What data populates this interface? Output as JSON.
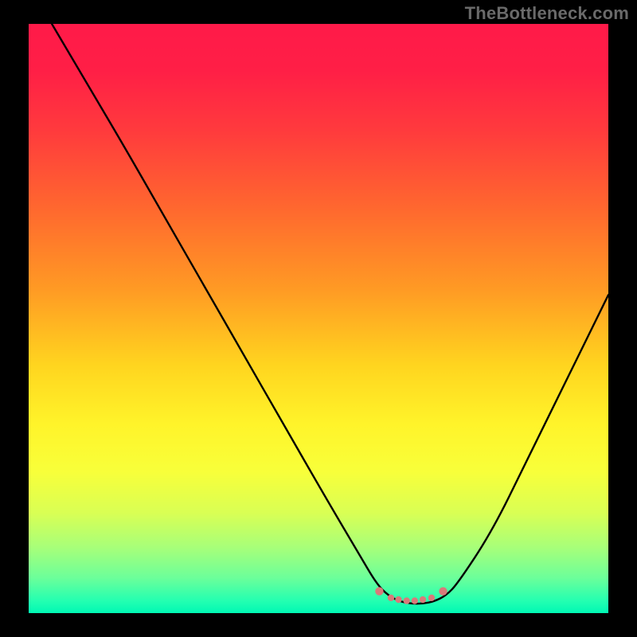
{
  "watermark": "TheBottleneck.com",
  "colors": {
    "background": "#000000",
    "watermark_text": "#6a6a6a",
    "curve_stroke": "#000000",
    "plateau_dot": "#d97a7a",
    "gradient_top": "#ff1a49",
    "gradient_bottom": "#00f8b4"
  },
  "chart_data": {
    "type": "line",
    "title": "",
    "xlabel": "",
    "ylabel": "",
    "xlim": [
      0,
      100
    ],
    "ylim": [
      0,
      100
    ],
    "grid": false,
    "legend": false,
    "series": [
      {
        "name": "bottleneck-curve",
        "x": [
          4,
          10,
          16,
          23,
          30,
          37,
          44,
          51,
          57,
          60,
          62,
          64,
          66,
          68,
          70,
          72,
          74,
          80,
          86,
          92,
          100
        ],
        "y": [
          100,
          90,
          80,
          68,
          56,
          44,
          32,
          20,
          10,
          5,
          3,
          2,
          1.6,
          1.6,
          2,
          3,
          5,
          14,
          26,
          38,
          54
        ]
      }
    ],
    "plateau": {
      "x": [
        60.5,
        62.5,
        63.8,
        65.2,
        66.6,
        68.0,
        69.5,
        71.5
      ],
      "y": [
        3.7,
        2.6,
        2.3,
        2.1,
        2.1,
        2.3,
        2.6,
        3.7
      ]
    }
  }
}
